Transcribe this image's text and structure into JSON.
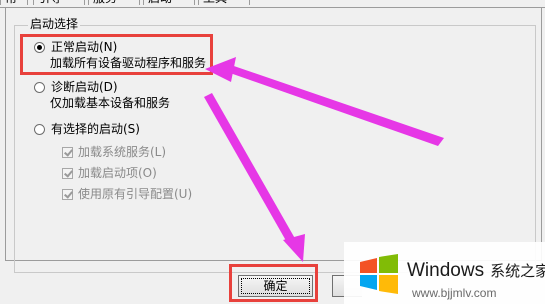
{
  "tabs": [
    {
      "label": "常规"
    },
    {
      "label": "引导"
    },
    {
      "label": "服务"
    },
    {
      "label": "启动"
    },
    {
      "label": "工具"
    }
  ],
  "group": {
    "title": "启动选择"
  },
  "options": [
    {
      "label": "正常启动(N)",
      "description": "加载所有设备驱动程序和服务",
      "selected": true
    },
    {
      "label": "诊断启动(D)",
      "description": "仅加载基本设备和服务",
      "selected": false
    },
    {
      "label": "有选择的启动(S)",
      "selected": false
    }
  ],
  "sub_options": [
    {
      "label": "加载系统服务(L)",
      "checked": true,
      "disabled": true
    },
    {
      "label": "加载启动项(O)",
      "checked": true,
      "disabled": true
    },
    {
      "label": "使用原有引导配置(U)",
      "checked": true,
      "disabled": true
    }
  ],
  "buttons": {
    "ok": "确定"
  },
  "watermark": {
    "brand": "Windows",
    "name": "系统之家",
    "url": "www.bjjmlv.com"
  },
  "colors": {
    "highlight": "#e8413c",
    "arrow": "#e637e6",
    "logo": [
      "#f35325",
      "#81bc06",
      "#05a6f0",
      "#ffba08"
    ]
  }
}
